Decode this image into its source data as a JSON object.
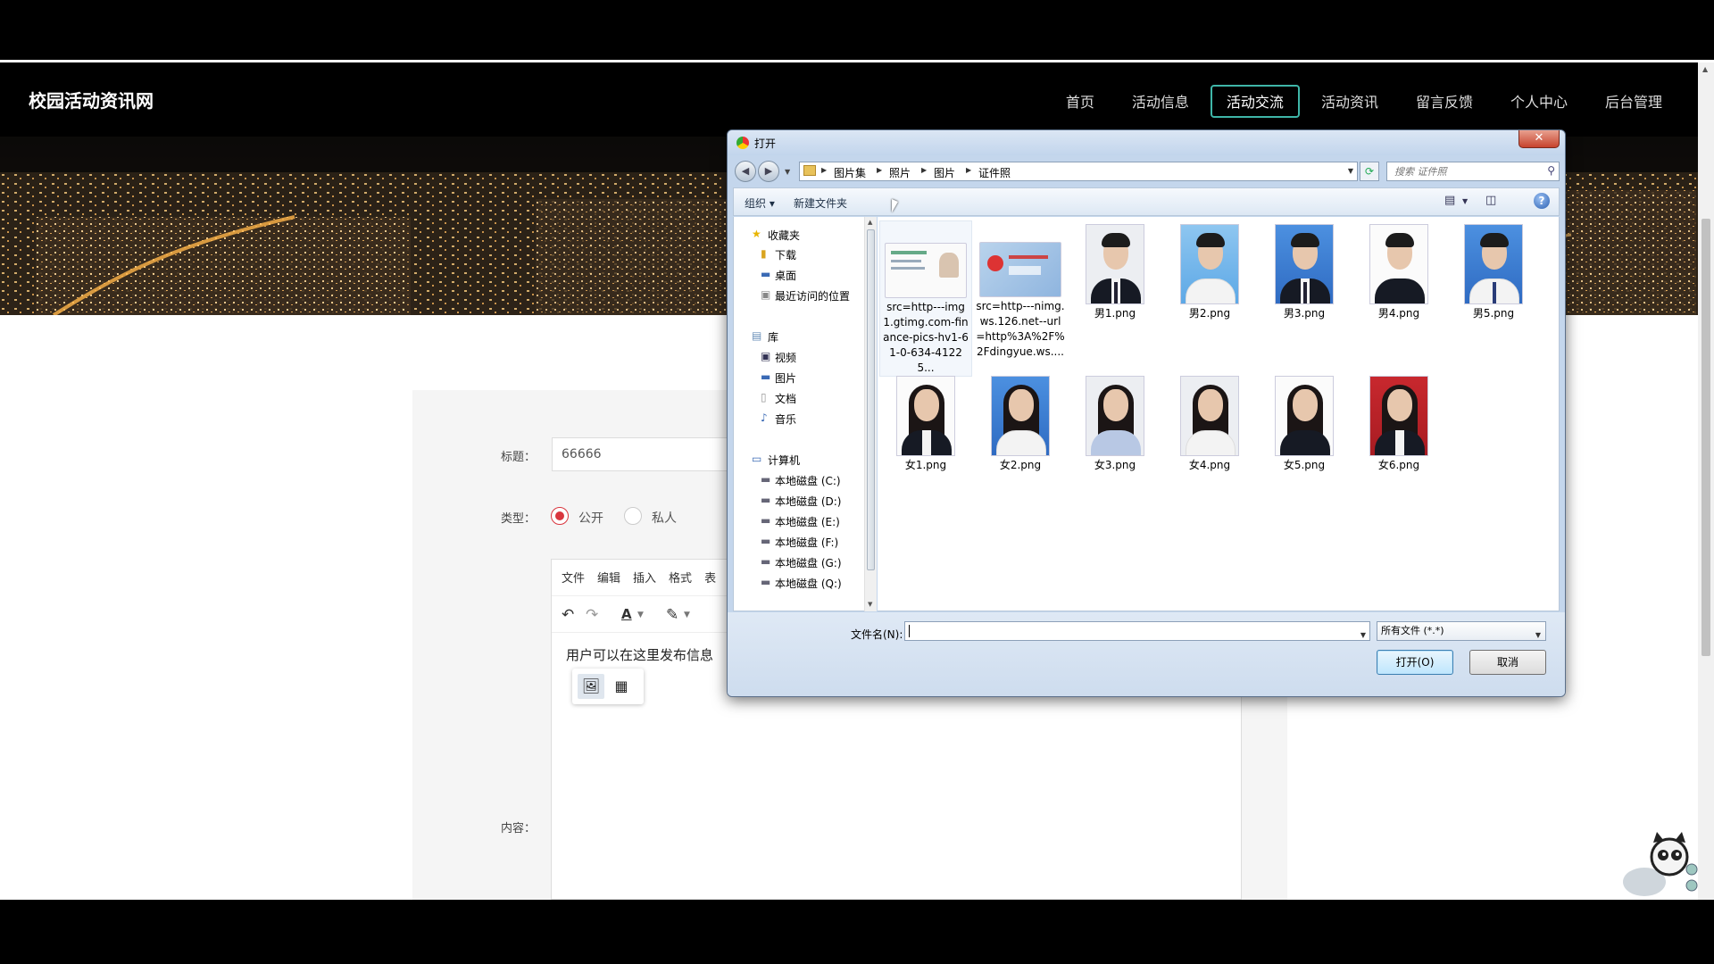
{
  "site": {
    "logo": "校园活动资讯网",
    "nav": [
      "首页",
      "活动信息",
      "活动交流",
      "活动资讯",
      "留言反馈",
      "个人中心",
      "后台管理"
    ],
    "active_nav": "活动交流"
  },
  "form": {
    "title_label": "标题：",
    "title_value": "66666",
    "type_label": "类型：",
    "type_options": [
      "公开",
      "私人"
    ],
    "type_selected": "公开",
    "content_label": "内容：",
    "editor_menu": [
      "文件",
      "编辑",
      "插入",
      "格式",
      "表"
    ],
    "editor_placeholder": "用户可以在这里发布信息"
  },
  "dialog": {
    "title": "打开",
    "breadcrumb": [
      "图片集",
      "照片",
      "图片",
      "证件照"
    ],
    "search_placeholder": "搜索 证件照",
    "commands": {
      "organize": "组织 ▾",
      "new_folder": "新建文件夹"
    },
    "nav_tree": {
      "favorites": {
        "label": "收藏夹",
        "items": [
          "下载",
          "桌面",
          "最近访问的位置"
        ]
      },
      "libraries": {
        "label": "库",
        "items": [
          "视频",
          "图片",
          "文档",
          "音乐"
        ]
      },
      "computer": {
        "label": "计算机",
        "items": [
          "本地磁盘 (C:)",
          "本地磁盘 (D:)",
          "本地磁盘 (E:)",
          "本地磁盘 (F:)",
          "本地磁盘 (G:)",
          "本地磁盘 (Q:)"
        ]
      }
    },
    "files": [
      {
        "name": "src=http---img1.gtimg.com-finance-pics-hv1-61-0-634-41225...",
        "kind": "card"
      },
      {
        "name": "src=http---nimg.ws.126.net--url=http%3A%2F%2Fdingyue.ws....",
        "kind": "card"
      },
      {
        "name": "男1.png",
        "kind": "male",
        "bg": "light"
      },
      {
        "name": "男2.png",
        "kind": "male",
        "bg": "sky"
      },
      {
        "name": "男3.png",
        "kind": "male",
        "bg": "blue"
      },
      {
        "name": "男4.png",
        "kind": "male",
        "bg": "white"
      },
      {
        "name": "男5.png",
        "kind": "male",
        "bg": "blue"
      },
      {
        "name": "女1.png",
        "kind": "female",
        "bg": "white"
      },
      {
        "name": "女2.png",
        "kind": "female",
        "bg": "blue"
      },
      {
        "name": "女3.png",
        "kind": "female",
        "bg": "light"
      },
      {
        "name": "女4.png",
        "kind": "female",
        "bg": "light"
      },
      {
        "name": "女5.png",
        "kind": "female",
        "bg": "white"
      },
      {
        "name": "女6.png",
        "kind": "female",
        "bg": "red"
      }
    ],
    "filename_label": "文件名(N):",
    "filename_value": "",
    "filter": "所有文件 (*.*)",
    "open_button": "打开(O)",
    "cancel_button": "取消"
  },
  "colors": {
    "accent": "#3fb6a8",
    "radio": "#d9363e",
    "dialog_frame": "#c4d6ec"
  }
}
